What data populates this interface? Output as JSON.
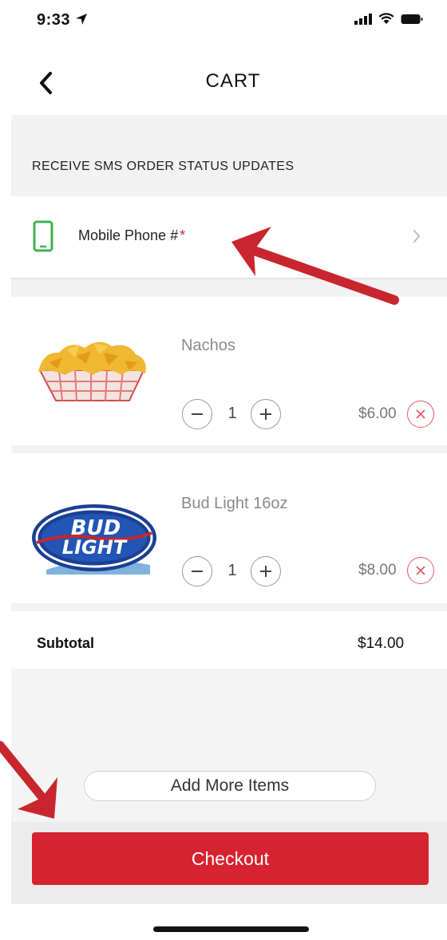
{
  "status_bar": {
    "time": "9:33"
  },
  "header": {
    "title": "CART"
  },
  "sms_section": {
    "title": "RECEIVE SMS ORDER STATUS UPDATES"
  },
  "phone_field": {
    "label": "Mobile Phone #",
    "required_mark": "*"
  },
  "cart": {
    "items": [
      {
        "name": "Nachos",
        "quantity": "1",
        "price": "$6.00",
        "image": "nachos-image"
      },
      {
        "name": "Bud Light 16oz",
        "quantity": "1",
        "price": "$8.00",
        "image": "bud-light-logo",
        "logo_line1": "BUD",
        "logo_line2": "LIGHT"
      }
    ],
    "subtotal_label": "Subtotal",
    "subtotal_value": "$14.00"
  },
  "actions": {
    "add_more_label": "Add More Items",
    "checkout_label": "Checkout"
  },
  "colors": {
    "accent": "#d7232f",
    "annotation_arrow": "#c8262e",
    "phone_icon": "#3fb34f"
  }
}
